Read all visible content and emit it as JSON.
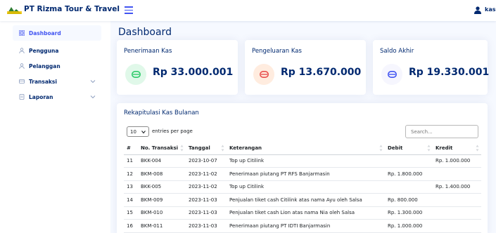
{
  "header": {
    "logo_text": "Rizma",
    "app_title": "PT Rizma Tour & Travel",
    "user_name": "kasir"
  },
  "sidebar": {
    "items": [
      {
        "label": "Dashboard"
      },
      {
        "label": "Pengguna"
      },
      {
        "label": "Pelanggan"
      },
      {
        "label": "Transaksi"
      },
      {
        "label": "Laporan"
      }
    ]
  },
  "page": {
    "title": "Dashboard"
  },
  "stats": [
    {
      "title": "Penerimaan Kas",
      "value": "Rp 33.000.001",
      "color": "#2eca6a"
    },
    {
      "title": "Pengeluaran Kas",
      "value": "Rp 13.670.000",
      "color": "#e8504e"
    },
    {
      "title": "Saldo Akhir",
      "value": "Rp 19.330.001",
      "color": "#4154f1"
    }
  ],
  "table": {
    "title": "Rekapitulasi Kas Bulanan",
    "entries_value": "10",
    "entries_label": "entries per page",
    "search_placeholder": "Search...",
    "columns": [
      "#",
      "No. Transaksi",
      "Tanggal",
      "Keterangan",
      "Debit",
      "Kredit"
    ],
    "rows": [
      [
        "11",
        "BKK-004",
        "2023-10-07",
        "Top up Citilink",
        "",
        "Rp. 1.000.000"
      ],
      [
        "12",
        "BKM-008",
        "2023-11-02",
        "Penerimaan piutang PT RFS Banjarmasin",
        "Rp. 1.800.000",
        ""
      ],
      [
        "13",
        "BKK-005",
        "2023-11-02",
        "Top up Citilink",
        "",
        "Rp. 1.400.000"
      ],
      [
        "14",
        "BKM-009",
        "2023-11-03",
        "Penjualan tiket cash Citilink atas nama Ayu oleh Salsa",
        "Rp. 800.000",
        ""
      ],
      [
        "15",
        "BKM-010",
        "2023-11-03",
        "Penjualan tiket cash Lion atas nama Nia oleh Salsa",
        "Rp. 1.300.000",
        ""
      ],
      [
        "16",
        "BKM-011",
        "2023-11-03",
        "Penerimaan piutang PT IDTI Banjarmasin",
        "Rp. 1.000.000",
        ""
      ]
    ]
  }
}
